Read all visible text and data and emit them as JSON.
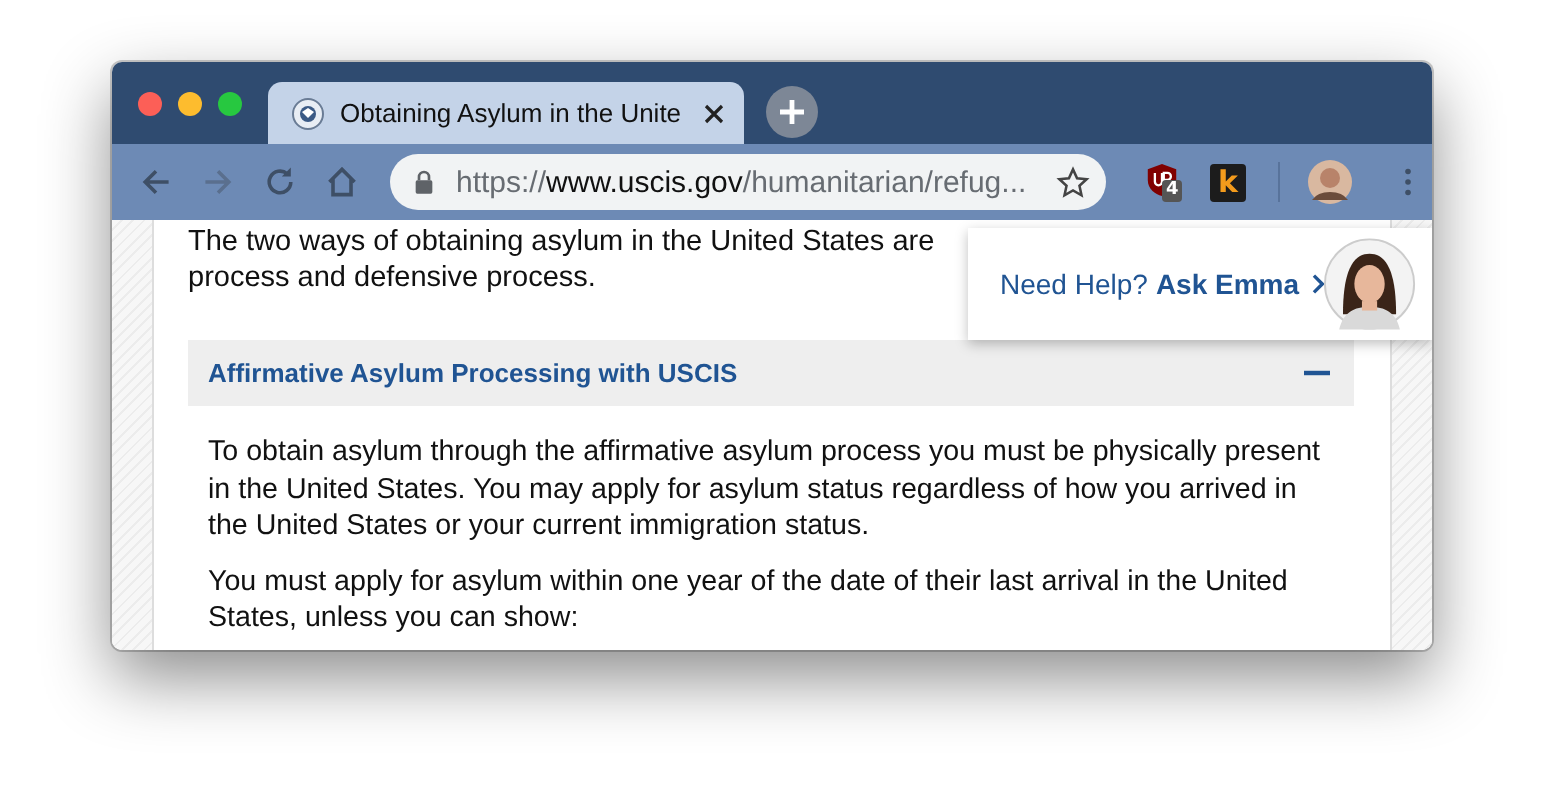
{
  "tabs": [
    {
      "title": "Obtaining Asylum in the Unite",
      "selected": true
    }
  ],
  "address_bar": {
    "scheme": "https://",
    "host": "www.uscis.gov",
    "path": "/humanitarian/refug..."
  },
  "extensions": [
    {
      "kind": "shield",
      "badge": "4"
    },
    {
      "kind": "letter",
      "label": "k"
    }
  ],
  "page": {
    "intro_lines": [
      "The two ways of obtaining asylum in the United States are",
      "process and defensive process."
    ],
    "accordion": {
      "title": "Affirmative Asylum Processing with USCIS",
      "expanded": true,
      "paragraphs": [
        "To obtain asylum through the affirmative asylum process you must be physically present in the United States. You may apply for asylum status regardless of how you arrived in the United States or your current immigration status.",
        "You must apply for asylum within one year of the date of their last arrival in the United States, unless you can show:"
      ]
    }
  },
  "help_popup": {
    "prompt": "Need Help?",
    "link": "Ask Emma"
  }
}
